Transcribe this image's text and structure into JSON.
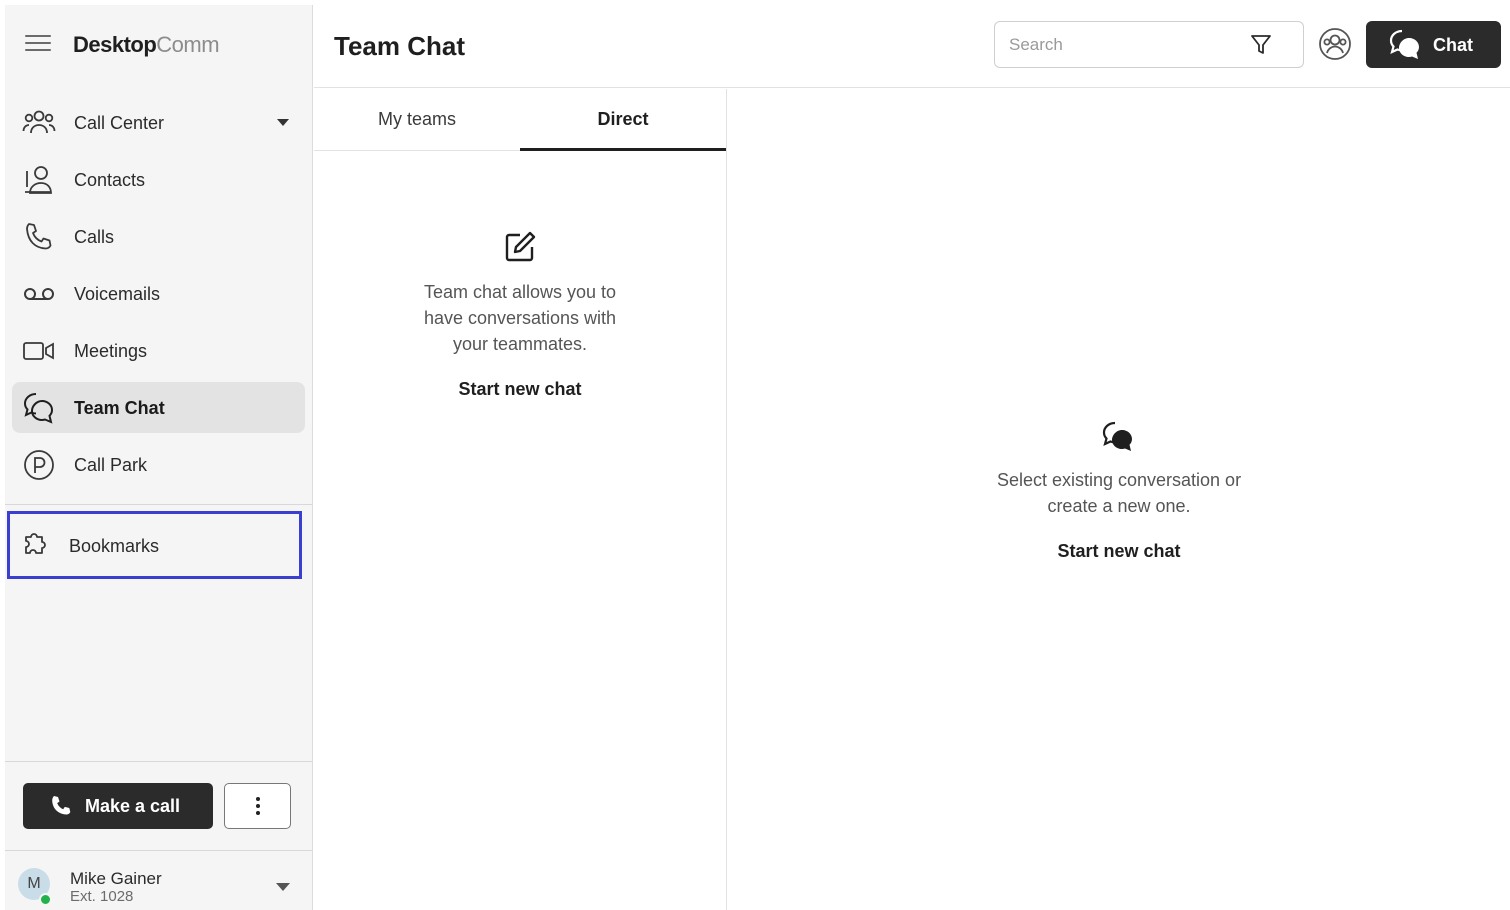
{
  "app": {
    "brand_bold": "Desktop",
    "brand_light": "Comm"
  },
  "sidebar": {
    "items": [
      {
        "label": "Call Center",
        "icon": "users-icon",
        "has_dropdown": true
      },
      {
        "label": "Contacts",
        "icon": "contacts-icon"
      },
      {
        "label": "Calls",
        "icon": "phone-icon"
      },
      {
        "label": "Voicemails",
        "icon": "voicemail-icon"
      },
      {
        "label": "Meetings",
        "icon": "video-icon"
      },
      {
        "label": "Team Chat",
        "icon": "chat-bubbles-icon",
        "active": true
      },
      {
        "label": "Call Park",
        "icon": "parking-icon"
      }
    ],
    "bookmarks": {
      "label": "Bookmarks",
      "icon": "puzzle-icon",
      "highlight_color": "#3a3fd0"
    },
    "make_call": {
      "label": "Make a call",
      "icon": "phone-icon"
    },
    "more": {
      "icon": "more-vertical-icon"
    },
    "user": {
      "initial": "M",
      "name": "Mike Gainer",
      "ext": "Ext. 1028",
      "status_color": "#21b24b"
    }
  },
  "header": {
    "title": "Team Chat",
    "search": {
      "placeholder": "Search"
    },
    "chat_button": {
      "label": "Chat"
    }
  },
  "tabs": [
    {
      "label": "My teams",
      "active": false
    },
    {
      "label": "Direct",
      "active": true
    }
  ],
  "direct_empty": {
    "text": "Team chat allows you to have conversations with your teammates.",
    "link": "Start new chat",
    "icon": "compose-icon"
  },
  "conversation_empty": {
    "text": "Select existing conversation or create a new one.",
    "link": "Start new chat",
    "icon": "chat-bubbles-icon"
  },
  "colors": {
    "dark_button": "#2b2b2b",
    "active_nav": "#e3e3e3",
    "sidebar_bg": "#f5f5f5"
  }
}
